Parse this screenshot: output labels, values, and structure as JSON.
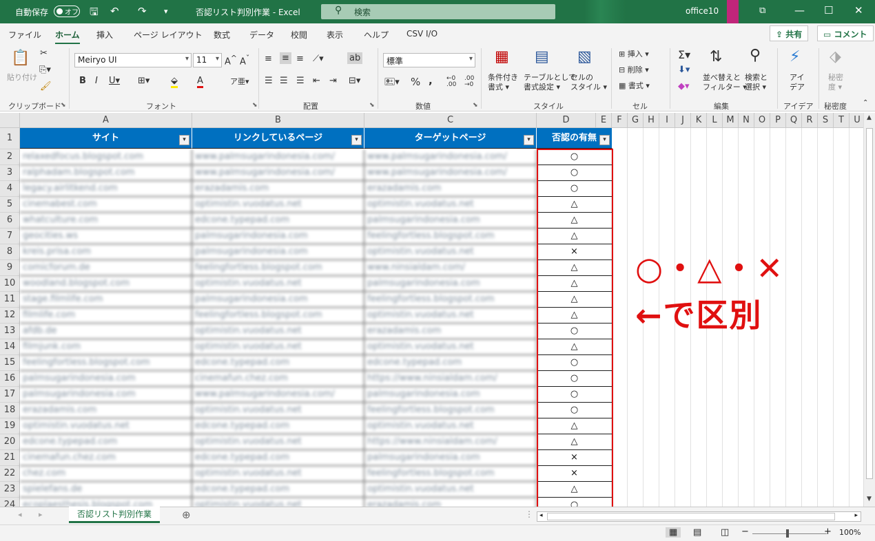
{
  "titlebar": {
    "autosave_label": "自動保存",
    "autosave_state": "オフ",
    "doc_title": "否認リスト判別作業  -  Excel",
    "search_placeholder": "検索",
    "user": "office10",
    "brand_color": "#217346"
  },
  "tabs": [
    "ファイル",
    "ホーム",
    "挿入",
    "ページ レイアウト",
    "数式",
    "データ",
    "校閲",
    "表示",
    "ヘルプ",
    "CSV I/O"
  ],
  "active_tab": "ホーム",
  "share_label": "共有",
  "comment_label": "コメント",
  "ribbon": {
    "clipboard": {
      "label": "クリップボード",
      "paste": "貼り付け"
    },
    "font": {
      "label": "フォント",
      "font_name": "Meiryo UI",
      "font_size": "11"
    },
    "alignment": {
      "label": "配置"
    },
    "number": {
      "label": "数値",
      "format": "標準"
    },
    "style": {
      "label": "スタイル",
      "cond_format": [
        "条件付き",
        "書式"
      ],
      "table_format": [
        "テーブルとして",
        "書式設定"
      ],
      "cell_style": [
        "セルの",
        "スタイル"
      ]
    },
    "cells": {
      "label": "セル",
      "insert": "挿入",
      "delete": "削除",
      "format": "書式"
    },
    "edit": {
      "label": "編集",
      "sort_filter": [
        "並べ替えと",
        "フィルター"
      ],
      "find_select": [
        "検索と",
        "選択"
      ]
    },
    "ideas": {
      "label": "アイデア",
      "btn": [
        "アイ",
        "デア"
      ]
    },
    "sensitivity": {
      "label": "秘密度",
      "btn": [
        "秘密",
        "度"
      ]
    }
  },
  "columns": [
    "A",
    "B",
    "C",
    "D",
    "E",
    "F",
    "G",
    "H",
    "I",
    "J",
    "K",
    "L",
    "M",
    "N",
    "O",
    "P",
    "Q",
    "R",
    "S",
    "T",
    "U"
  ],
  "table": {
    "headers": [
      "サイト",
      "リンクしているページ",
      "ターゲットページ",
      "否認の有無"
    ],
    "rows": [
      [
        "2",
        "relaxedfocus.blogspot.com",
        "www.palmsugarindonesia.com/",
        "www.palmsugarindonesia.com/",
        "○"
      ],
      [
        "3",
        "ralphadam.blogspot.com",
        "www.palmsugarindonesia.com/",
        "www.palmsugarindonesia.com/",
        "○"
      ],
      [
        "4",
        "legacy.airlitkend.com",
        "erazadamis.com",
        "erazadamis.com",
        "○"
      ],
      [
        "5",
        "cinemabest.com",
        "optimistin.vuodatus.net",
        "optimistin.vuodatus.net",
        "△"
      ],
      [
        "6",
        "whatculture.com",
        "edcone.typepad.com",
        "palmsugarindonesia.com",
        "△"
      ],
      [
        "7",
        "geocities.ws",
        "palmsugarindonesia.com",
        "feelingfortless.blogspot.com",
        "△"
      ],
      [
        "8",
        "kreis.prisa.com",
        "palmsugarindonesia.com",
        "optimistin.vuodatus.net",
        "×"
      ],
      [
        "9",
        "comicforum.de",
        "feelingfortless.blogspot.com",
        "www.ninsialdam.com/",
        "△"
      ],
      [
        "10",
        "woodland.blogspot.com",
        "optimistin.vuodatus.net",
        "palmsugarindonesia.com",
        "△"
      ],
      [
        "11",
        "stage.filmlife.com",
        "palmsugarindonesia.com",
        "feelingfortless.blogspot.com",
        "△"
      ],
      [
        "12",
        "filmlife.com",
        "feelingfortless.blogspot.com",
        "optimistin.vuodatus.net",
        "△"
      ],
      [
        "13",
        "afdb.de",
        "optimistin.vuodatus.net",
        "erazadamis.com",
        "○"
      ],
      [
        "14",
        "filmjunk.com",
        "optimistin.vuodatus.net",
        "optimistin.vuodatus.net",
        "△"
      ],
      [
        "15",
        "feelingfortless.blogspot.com",
        "edcone.typepad.com",
        "edcone.typepad.com",
        "○"
      ],
      [
        "16",
        "palmsugarindonesia.com",
        "cinemafun.chez.com",
        "https://www.ninsialdam.com/",
        "○"
      ],
      [
        "17",
        "palmsugarindonesia.com",
        "www.palmsugarindonesia.com/",
        "palmsugarindonesia.com",
        "○"
      ],
      [
        "18",
        "erazadamis.com",
        "optimistin.vuodatus.net",
        "feelingfortless.blogspot.com",
        "○"
      ],
      [
        "19",
        "optimistin.vuodatus.net",
        "edcone.typepad.com",
        "optimistin.vuodatus.net",
        "△"
      ],
      [
        "20",
        "edcone.typepad.com",
        "optimistin.vuodatus.net",
        "https://www.ninsialdam.com/",
        "△"
      ],
      [
        "21",
        "cinemafun.chez.com",
        "edcone.typepad.com",
        "palmsugarindonesia.com",
        "×"
      ],
      [
        "22",
        "chez.com",
        "optimistin.vuodatus.net",
        "feelingfortless.blogspot.com",
        "×"
      ],
      [
        "23",
        "spielefans.de",
        "edcone.typepad.com",
        "optimistin.vuodatus.net",
        "△"
      ],
      [
        "24",
        "ecoplaesthesis.blogspot.com",
        "optimistin.vuodatus.net",
        "erazadamis.com",
        "○"
      ]
    ]
  },
  "annotation": {
    "line1": "○・△・✕",
    "line2": "←で区別",
    "color": "#e01010"
  },
  "sheet_tab": "否認リスト判別作業",
  "zoom": "100%",
  "zoom_fraction": 0.5
}
